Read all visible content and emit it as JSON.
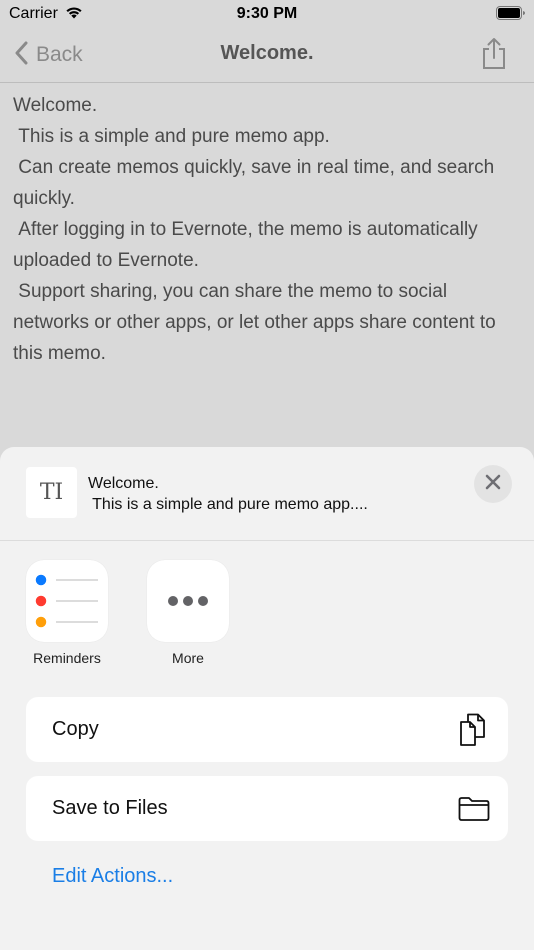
{
  "status_bar": {
    "carrier": "Carrier",
    "time": "9:30 PM"
  },
  "nav": {
    "back_label": "Back",
    "title": "Welcome."
  },
  "memo": {
    "text": "Welcome.\n This is a simple and pure memo app.\n Can create memos quickly, save in real time, and search quickly.\n After logging in to Evernote, the memo is automatically uploaded to Evernote.\n Support sharing, you can share the memo to social networks or other apps, or let other apps share content to this memo."
  },
  "share_sheet": {
    "preview_title": "Welcome.",
    "preview_subtitle": " This is a simple and pure memo app....",
    "thumb_text": "TI",
    "apps": [
      {
        "label": "Reminders",
        "icon": "reminders-icon"
      },
      {
        "label": "More",
        "icon": "more-icon"
      }
    ],
    "actions": [
      {
        "label": "Copy",
        "icon": "copy-icon"
      },
      {
        "label": "Save to Files",
        "icon": "folder-icon"
      }
    ],
    "edit_actions_label": "Edit Actions..."
  },
  "colors": {
    "accent": "#1a7ee6",
    "reminder_blue": "#0a7aff",
    "reminder_red": "#ff3b30",
    "reminder_orange": "#ff9f0a"
  }
}
